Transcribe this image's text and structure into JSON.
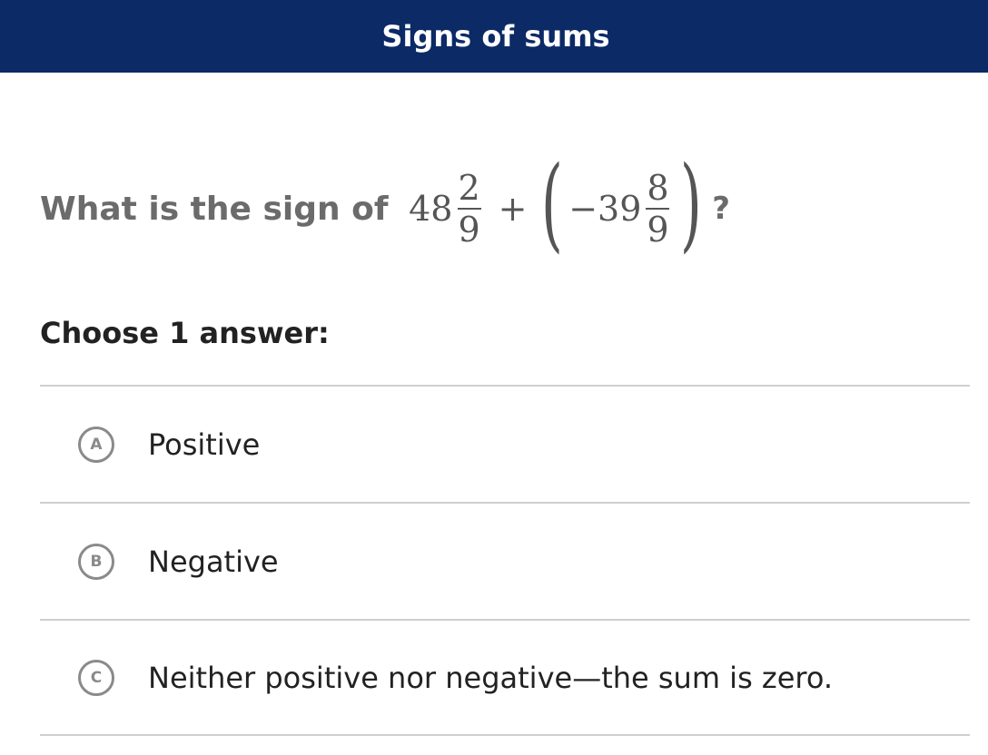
{
  "header": {
    "title": "Signs of sums"
  },
  "question": {
    "prefix": "What is the sign of ",
    "expression": {
      "term1_whole": "48",
      "term1_num": "2",
      "term1_den": "9",
      "operator": "+",
      "term2_whole": "−39",
      "term2_num": "8",
      "term2_den": "9"
    },
    "suffix": "?"
  },
  "choose_label": "Choose 1 answer:",
  "answers": [
    {
      "letter": "A",
      "label": "Positive"
    },
    {
      "letter": "B",
      "label": "Negative"
    },
    {
      "letter": "C",
      "label": "Neither positive nor negative—the sum is zero."
    }
  ],
  "colors": {
    "header_bg": "#0c2a66",
    "divider": "#cfcfcf"
  }
}
